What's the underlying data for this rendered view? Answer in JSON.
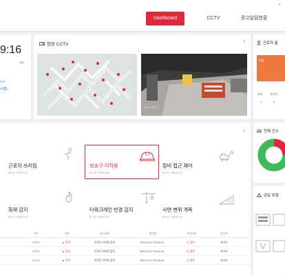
{
  "nav": {
    "tabs": [
      {
        "label": "Dashboard",
        "active": true
      },
      {
        "label": "CCTV",
        "active": false
      },
      {
        "label": "경고알림현황",
        "active": false
      }
    ],
    "close": "×"
  },
  "clock": {
    "time": "9:16",
    "sub": "일요",
    "mini1": "러비",
    "mini2": "ul"
  },
  "cctv": {
    "title": "현장 CCTV",
    "feed_caption": "우회전 출입구"
  },
  "worker": {
    "title": "근로자 출",
    "labels": [
      "여성",
      "외국인"
    ],
    "values": [
      "1",
      "0"
    ]
  },
  "status": {
    "cells": [
      {
        "title": "근로자 쓰러짐",
        "sub": "총 0건 / 미조치 0건"
      },
      {
        "title": "보호구 미착용",
        "sub": "총 4건 / 미조치 4건",
        "highlighted": true
      },
      {
        "title": "장비 접근 제어",
        "sub": "총 0건 / 미조치 0건"
      },
      {
        "title": "화재 감지",
        "sub": "총 0건 / 미조치 0건"
      },
      {
        "title": "타워크레인 반경 감지",
        "sub": "총 0건 / 미조치 0건"
      },
      {
        "title": "사면 변위 계측",
        "sub": "총 0건 / 미조치 0건"
      }
    ]
  },
  "table": {
    "headers": [
      "구분",
      "경보",
      "경고내용",
      "발생일",
      "처리상태",
      "담당자"
    ],
    "rows": [
      [
        "CCTV",
        "▲ 주의",
        "안전모 미착용 탐지",
        "2020.04.27 09:46:23",
        "⚠ 경보",
        "처리자"
      ],
      [
        "CCTV",
        "▲ 주의",
        "안전모 미착용 탐지",
        "2020.04.27 09:41:26",
        "⚠ 경보",
        "처리자"
      ],
      [
        "CCTV",
        "▲ 주의",
        "안전모 미착용 탐지",
        "2020.04.27 09:38:44",
        "⚠ 경보",
        "처리자"
      ]
    ]
  },
  "right": {
    "pie_title": "전체 건수",
    "alarm_title": "금일 위험"
  },
  "colors": {
    "accent": "#e0283c",
    "orange": "#ef7a3f",
    "green": "#3dbb5a"
  }
}
